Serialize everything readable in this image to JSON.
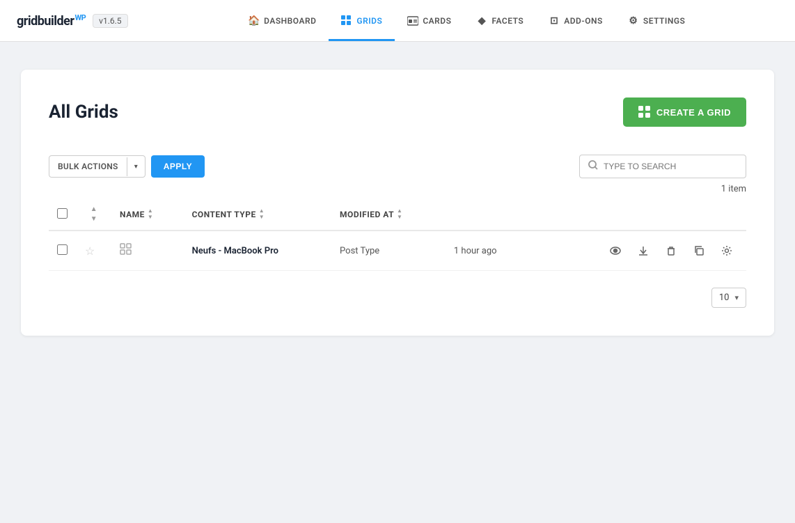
{
  "app": {
    "logo": "gridbuilder",
    "logo_wp": "WP",
    "version": "v1.6.5"
  },
  "nav": {
    "items": [
      {
        "id": "dashboard",
        "label": "DASHBOARD",
        "icon": "🏠",
        "active": false
      },
      {
        "id": "grids",
        "label": "GRIDS",
        "icon": "⊞",
        "active": true
      },
      {
        "id": "cards",
        "label": "CARDS",
        "icon": "🪪",
        "active": false
      },
      {
        "id": "facets",
        "label": "FACETS",
        "icon": "◆",
        "active": false
      },
      {
        "id": "add-ons",
        "label": "ADD-ONS",
        "icon": "⊡",
        "active": false
      },
      {
        "id": "settings",
        "label": "SETTINGS",
        "icon": "⚙",
        "active": false
      }
    ]
  },
  "page": {
    "title": "All Grids",
    "create_button": "CREATE A GRID",
    "item_count": "1 item"
  },
  "toolbar": {
    "bulk_actions_label": "BULK ACTIONS",
    "apply_label": "APPLY",
    "search_placeholder": "TYPE TO SEARCH"
  },
  "table": {
    "columns": [
      {
        "id": "name",
        "label": "NAME",
        "sortable": true
      },
      {
        "id": "content_type",
        "label": "CONTENT TYPE",
        "sortable": true
      },
      {
        "id": "modified_at",
        "label": "MODIFIED AT",
        "sortable": true
      }
    ],
    "rows": [
      {
        "id": 1,
        "name": "Neufs - MacBook Pro",
        "content_type": "Post Type",
        "modified_at": "1 hour ago"
      }
    ]
  },
  "pagination": {
    "per_page": "10"
  },
  "colors": {
    "active_nav": "#2196f3",
    "create_btn": "#4caf50",
    "apply_btn": "#2196f3"
  }
}
